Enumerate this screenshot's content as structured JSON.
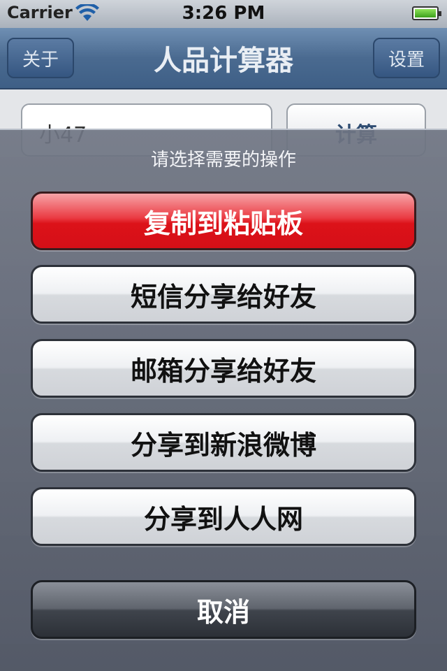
{
  "status_bar": {
    "carrier": "Carrier",
    "time": "3:26 PM"
  },
  "nav_bar": {
    "left_button": "关于",
    "title": "人品计算器",
    "right_button": "设置"
  },
  "background": {
    "input_value": "小47",
    "calc_button": "计算"
  },
  "action_sheet": {
    "title": "请选择需要的操作",
    "buttons": [
      {
        "label": "复制到粘贴板",
        "style": "destructive",
        "color": "#dc1219"
      },
      {
        "label": "短信分享给好友",
        "style": "default"
      },
      {
        "label": "邮箱分享给好友",
        "style": "default"
      },
      {
        "label": "分享到新浪微博",
        "style": "default"
      },
      {
        "label": "分享到人人网",
        "style": "default"
      }
    ],
    "cancel_label": "取消"
  },
  "icons": {
    "wifi": "wifi-icon",
    "battery": "battery-icon"
  }
}
